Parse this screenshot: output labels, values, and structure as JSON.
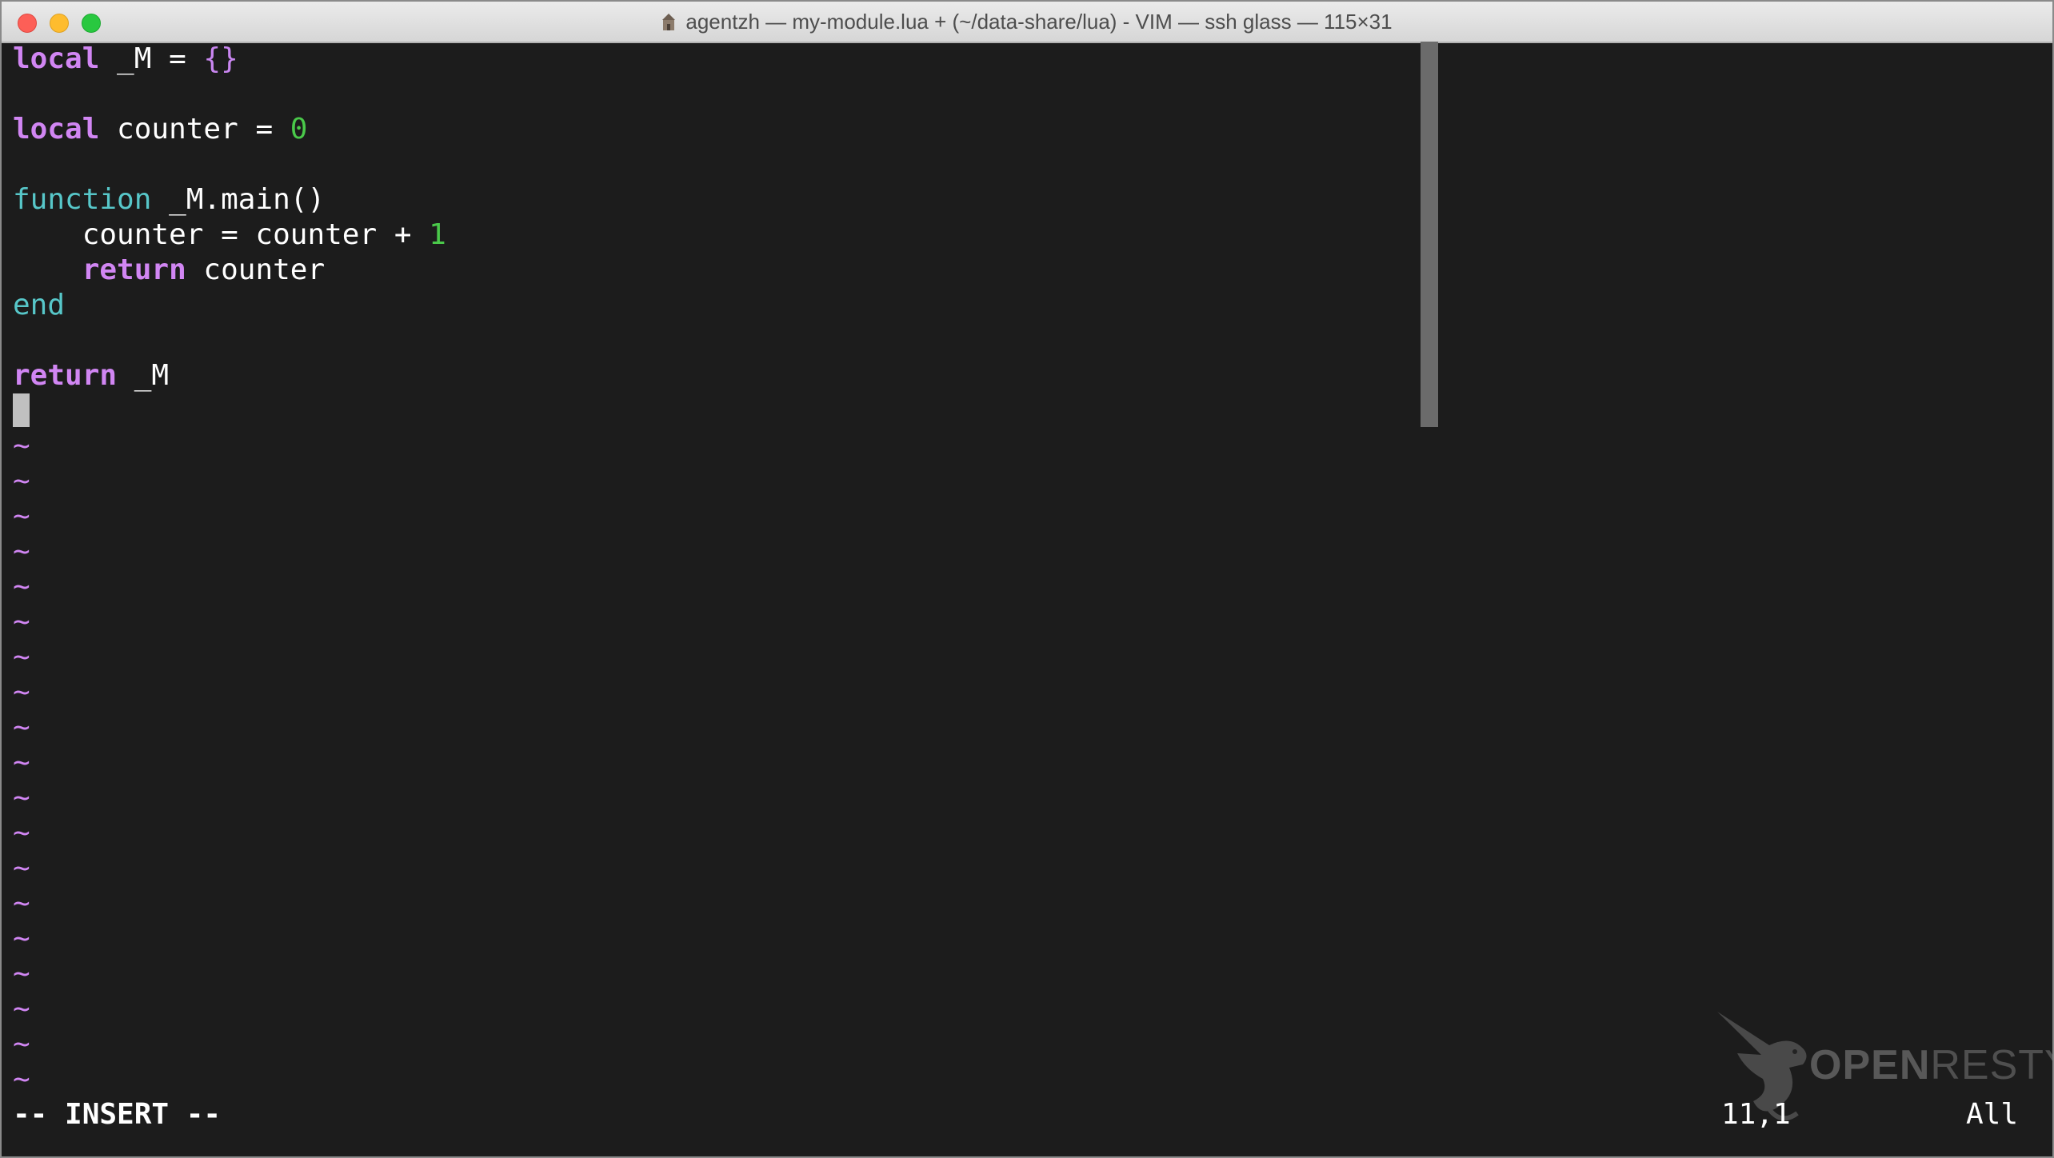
{
  "window": {
    "title": "agentzh — my-module.lua + (~/data-share/lua) - VIM — ssh glass — 115×31"
  },
  "buffer": {
    "lines": [
      [
        {
          "t": "local",
          "c": "kw"
        },
        {
          "t": " _M = ",
          "c": "plain"
        },
        {
          "t": "{}",
          "c": "brace"
        }
      ],
      [],
      [
        {
          "t": "local",
          "c": "kw"
        },
        {
          "t": " counter = ",
          "c": "plain"
        },
        {
          "t": "0",
          "c": "num"
        }
      ],
      [],
      [
        {
          "t": "function",
          "c": "fn"
        },
        {
          "t": " _M.main()",
          "c": "plain"
        }
      ],
      [
        {
          "t": "    counter = counter + ",
          "c": "plain"
        },
        {
          "t": "1",
          "c": "num"
        }
      ],
      [
        {
          "t": "    ",
          "c": "plain"
        },
        {
          "t": "return",
          "c": "kw"
        },
        {
          "t": " counter",
          "c": "plain"
        }
      ],
      [
        {
          "t": "end",
          "c": "fn"
        }
      ],
      [],
      [
        {
          "t": "return",
          "c": "kw"
        },
        {
          "t": " _M",
          "c": "plain"
        }
      ]
    ],
    "tilde_char": "~",
    "tilde_count": 19
  },
  "status": {
    "mode": "-- INSERT --",
    "position": "11,1",
    "scroll": "All"
  },
  "watermark": {
    "open": "OPEN",
    "resty": "RESTY"
  },
  "colors": {
    "keyword": "#d186f3",
    "function": "#57c7c9",
    "number": "#4ac94a",
    "background": "#1c1c1c"
  }
}
